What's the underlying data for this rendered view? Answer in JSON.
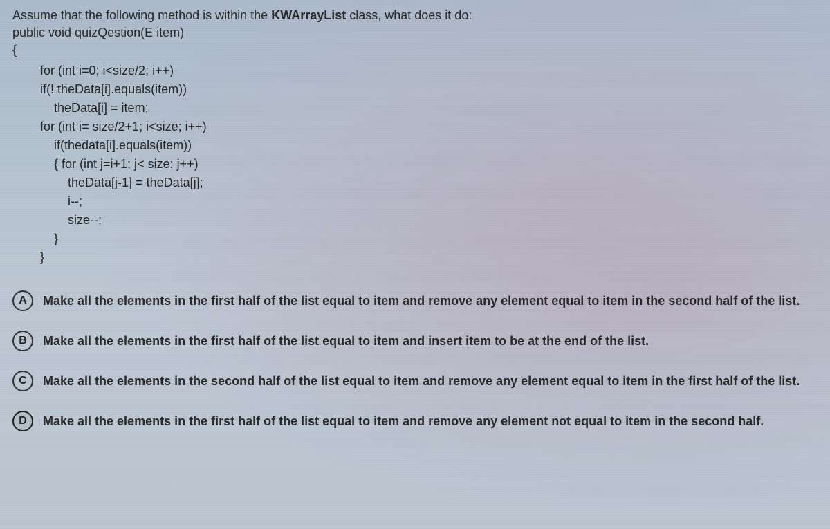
{
  "question": {
    "prompt_prefix": "Assume that the following method is within the ",
    "class_name": "KWArrayList",
    "prompt_suffix": " class, what does it do:",
    "signature": "public void quizQestion(E item)",
    "brace_open": "{",
    "code": {
      "l1": "for (int i=0; i<size/2; i++)",
      "l2": "if(! theData[i].equals(item))",
      "l3": "theData[i] = item;",
      "l4": "for (int i= size/2+1; i<size; i++)",
      "l5": "if(thedata[i].equals(item))",
      "l6": "{ for (int j=i+1; j< size; j++)",
      "l7": "theData[j-1] = theData[j];",
      "l8": "i--;",
      "l9": "size--;",
      "l10": "}",
      "l11": "}"
    }
  },
  "options": {
    "a": {
      "letter": "A",
      "text": "Make all the elements in the first half of the list equal to item and remove any element equal to item in the second half of the list."
    },
    "b": {
      "letter": "B",
      "text": "Make all the elements in the first half of the list equal to item and insert item to be at the end of the list."
    },
    "c": {
      "letter": "C",
      "text": "Make all the elements in the second half of the list equal to item and remove any element equal to item in the first half of the list."
    },
    "d": {
      "letter": "D",
      "text": "Make all the elements in the first half of the list equal to item and remove any element not equal to item in the second half."
    }
  }
}
